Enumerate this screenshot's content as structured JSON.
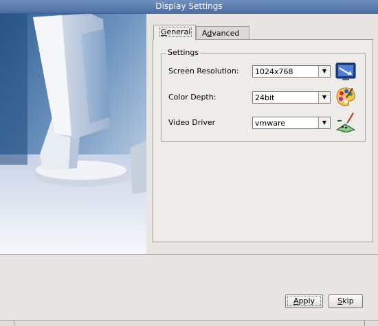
{
  "window": {
    "title": "Display Settings"
  },
  "tabs": [
    {
      "label": "General",
      "mnemonic": "G",
      "rest": "eneral",
      "active": true
    },
    {
      "label": "Advanced",
      "prefix": "A",
      "mnemonic": "d",
      "rest": "vanced",
      "active": false
    }
  ],
  "settings": {
    "group_title": "Settings",
    "rows": [
      {
        "label": "Screen Resolution:",
        "value": "1024x768",
        "icon": "monitor-resolution-icon"
      },
      {
        "label": "Color Depth:",
        "value": "24bit",
        "icon": "color-palette-icon"
      },
      {
        "label": "Video Driver",
        "value": "vmware",
        "icon": "video-card-icon"
      }
    ]
  },
  "buttons": {
    "apply": {
      "label": "Apply",
      "mnemonic": "A",
      "rest": "pply"
    },
    "skip": {
      "label": "Skip",
      "mnemonic": "S",
      "rest": "kip"
    }
  },
  "colors": {
    "titlebar": "#4c6ea4",
    "background": "#e8e6e2"
  }
}
